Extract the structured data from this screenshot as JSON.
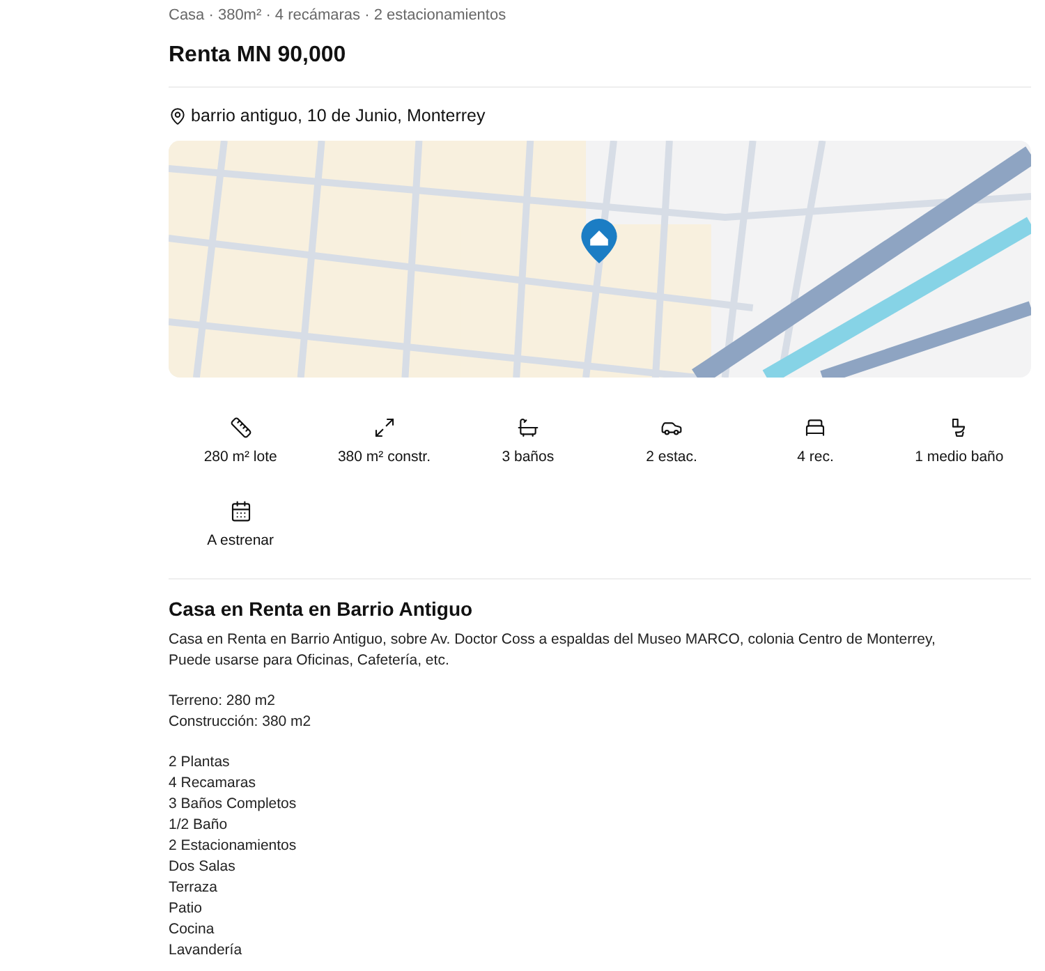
{
  "summary": "Casa · 380m² · 4 recámaras · 2 estacionamientos",
  "price": "Renta MN 90,000",
  "location": "barrio antiguo, 10 de Junio, Monterrey",
  "features": [
    {
      "kind": "lot",
      "label": "280 m² lote"
    },
    {
      "kind": "built",
      "label": "380 m² constr."
    },
    {
      "kind": "bath",
      "label": "3 baños"
    },
    {
      "kind": "parking",
      "label": "2 estac."
    },
    {
      "kind": "bedroom",
      "label": "4 rec."
    },
    {
      "kind": "half_bath",
      "label": "1 medio baño"
    },
    {
      "kind": "new",
      "label": "A estrenar"
    }
  ],
  "description": {
    "title": "Casa en Renta en Barrio Antiguo",
    "paragraphs": [
      [
        "Casa en Renta en Barrio Antiguo, sobre Av. Doctor Coss a espaldas del Museo MARCO, colonia Centro de Monterrey,",
        "Puede usarse para Oficinas, Cafetería, etc."
      ],
      [
        "Terreno: 280 m2",
        "Construcción: 380 m2"
      ],
      [
        "2 Plantas",
        "4 Recamaras",
        "3 Baños Completos",
        "1/2 Baño",
        "2 Estacionamientos",
        "Dos Salas",
        "Terraza",
        "Patio",
        "Cocina",
        "Lavandería"
      ]
    ]
  }
}
